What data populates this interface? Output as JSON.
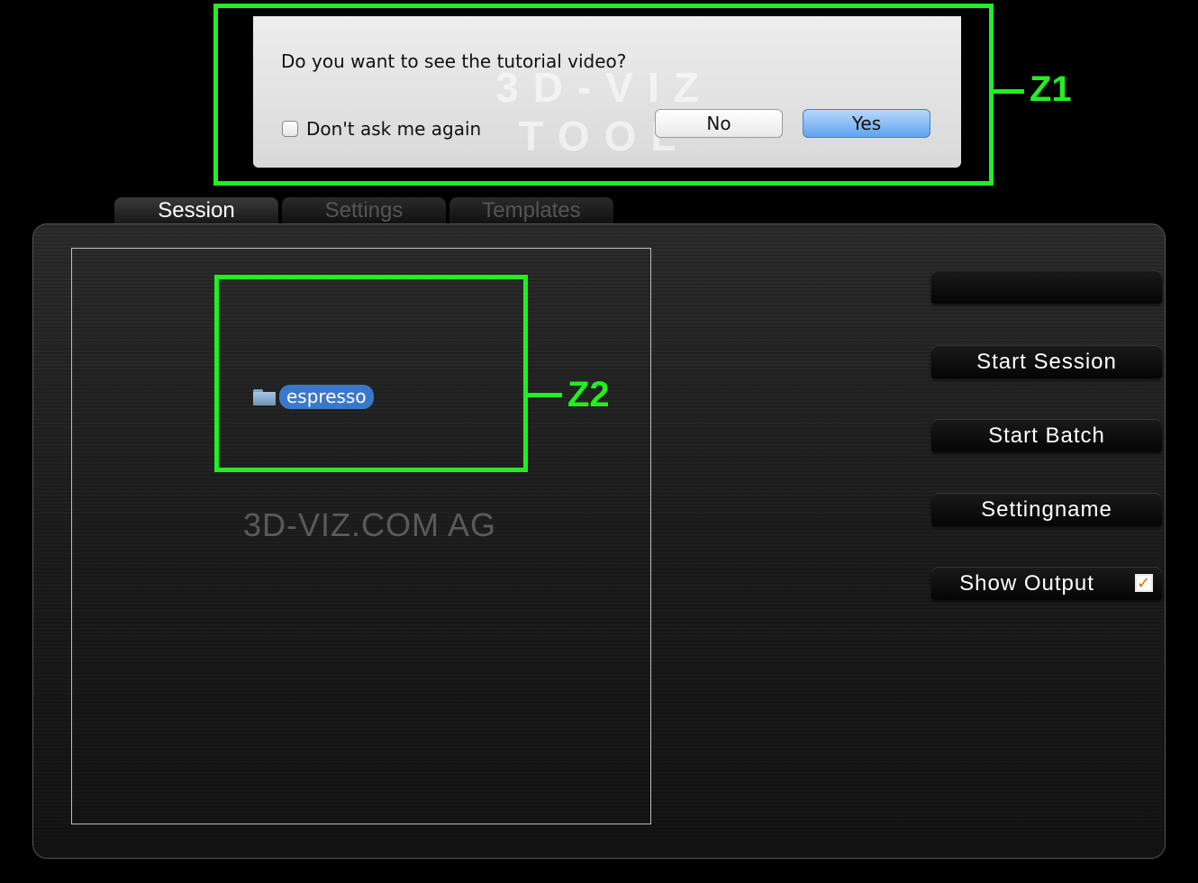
{
  "dialog": {
    "question": "Do you want to see the tutorial video?",
    "watermark": "3D-VIZ TOOL",
    "dont_ask_label": "Don't ask me again",
    "dont_ask_checked": false,
    "no_label": "No",
    "yes_label": "Yes"
  },
  "annotations": {
    "z1": "Z1",
    "z2": "Z2",
    "color": "#22ee22"
  },
  "tabs": [
    {
      "label": "Session",
      "active": true
    },
    {
      "label": "Settings",
      "active": false
    },
    {
      "label": "Templates",
      "active": false
    }
  ],
  "file_pane": {
    "folder_name": "espresso",
    "folder_icon": "folder-icon",
    "brand_watermark": "3D-VIZ.COM AG"
  },
  "actions": {
    "empty_label": "",
    "start_session": "Start Session",
    "start_batch": "Start Batch",
    "settingname": "Settingname",
    "show_output": "Show Output",
    "show_output_checked": true
  },
  "colors": {
    "selection": "#3b78c9",
    "yes_button": "#5ea3ef",
    "checkbox_mark": "#e06a10"
  }
}
